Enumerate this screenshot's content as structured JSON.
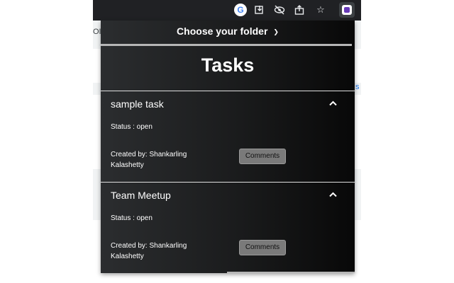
{
  "toolbar": {
    "icons": [
      "google-icon",
      "install-icon",
      "hide-icon",
      "share-icon",
      "star-icon",
      "extension-icon"
    ]
  },
  "background": {
    "left_snippet": "OI",
    "right_snippet": "s"
  },
  "popup": {
    "folder_select_label": "Choose your folder",
    "title": "Tasks",
    "tasks": [
      {
        "name": "sample task",
        "status": "Status : open",
        "created_by": "Created by: Shankarling Kalashetty",
        "comments_label": "Comments"
      },
      {
        "name": "Team Meetup",
        "status": "Status : open",
        "created_by": "Created by: Shankarling Kalashetty",
        "comments_label": "Comments"
      }
    ]
  },
  "colors": {
    "popup_background": "#1a1b1c",
    "button_background": "#7a7a7a",
    "rule": "#b6b6b6"
  }
}
